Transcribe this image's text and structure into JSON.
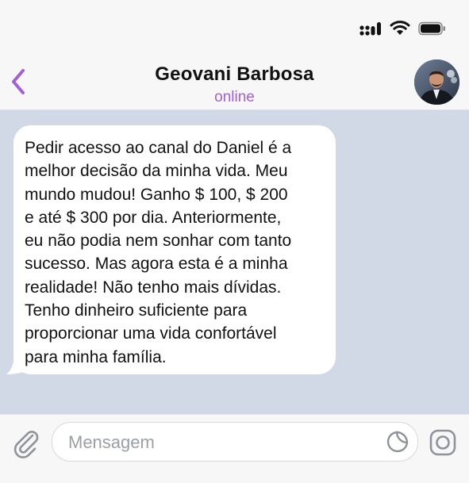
{
  "status_bar": {
    "icons": [
      "signal-icon",
      "wifi-icon",
      "battery-icon"
    ]
  },
  "header": {
    "contact_name": "Geovani Barbosa",
    "status": "online",
    "back_icon": "chevron-left-icon",
    "accent_color": "#a35fd8"
  },
  "chat": {
    "background_color": "#d1d9e6",
    "messages": [
      {
        "direction": "incoming",
        "text": "Pedir acesso ao canal do Daniel é a\nmelhor decisão da minha vida. Meu\nmundo mudou! Ganho $ 100, $ 200\ne até $ 300 por dia. Anteriormente,\neu não podia nem sonhar com tanto\nsucesso. Mas agora esta é a minha\nrealidade! Não tenho mais dívidas.\nTenho dinheiro suficiente para\nproporcionar uma vida confortável\npara minha família."
      }
    ]
  },
  "composer": {
    "placeholder": "Mensagem",
    "value": "",
    "icons": [
      "paperclip-icon",
      "sticker-icon",
      "camera-icon"
    ]
  }
}
